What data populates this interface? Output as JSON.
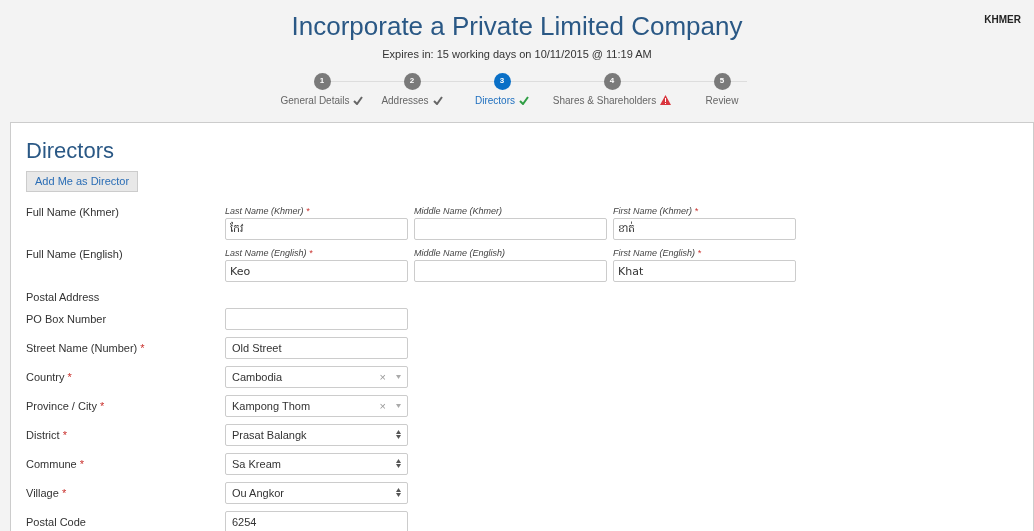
{
  "header": {
    "title": "Incorporate a Private Limited Company",
    "expires": "Expires in: 15 working days on 10/11/2015 @ 11:19 AM",
    "language": "KHMER"
  },
  "steps": [
    {
      "number": "1",
      "label": "General Details",
      "selected": false,
      "kind": "done"
    },
    {
      "number": "2",
      "label": "Addresses",
      "selected": false,
      "kind": "done"
    },
    {
      "number": "3",
      "label": "Directors",
      "selected": true,
      "kind": "done"
    },
    {
      "number": "4",
      "label": "Shares & Shareholders",
      "selected": false,
      "kind": "warning"
    },
    {
      "number": "5",
      "label": "Review",
      "selected": false,
      "kind": "plain"
    }
  ],
  "section": {
    "title": "Directors",
    "add_button": "Add Me as Director"
  },
  "name_rows": [
    {
      "label": "Full Name (Khmer)",
      "parts": [
        {
          "label": "Last Name (Khmer)",
          "marker": "*",
          "value": "កែវ"
        },
        {
          "label": "Middle Name (Khmer)"
        },
        {
          "label": "First Name (Khmer)",
          "marker": "*",
          "value": "ខាត់"
        }
      ]
    },
    {
      "label": "Full Name (English)",
      "parts": [
        {
          "label": "Last Name (English)",
          "marker": "*",
          "value": "Keo"
        },
        {
          "label": "Middle Name (English)"
        },
        {
          "label": "First Name (English)",
          "marker": "*",
          "value": "Khat"
        }
      ]
    }
  ],
  "postal_heading": "Postal Address",
  "address_rows": [
    {
      "label": "PO Box Number",
      "kind": "text"
    },
    {
      "label": "Street Name (Number)",
      "marker": "*",
      "kind": "text",
      "value": "Old Street"
    },
    {
      "label": "Country",
      "marker": "*",
      "kind": "combo",
      "value": "Cambodia",
      "clear": "×"
    },
    {
      "label": "Province / City",
      "marker": "*",
      "kind": "combo",
      "value": "Kampong Thom",
      "clear": "×"
    },
    {
      "label": "District",
      "marker": "*",
      "kind": "select",
      "value": "Prasat Balangk"
    },
    {
      "label": "Commune",
      "marker": "*",
      "kind": "select",
      "value": "Sa Kream"
    },
    {
      "label": "Village",
      "marker": "*",
      "kind": "select",
      "value": "Ou Angkor"
    },
    {
      "label": "Postal Code",
      "kind": "text",
      "value": "6254"
    }
  ]
}
